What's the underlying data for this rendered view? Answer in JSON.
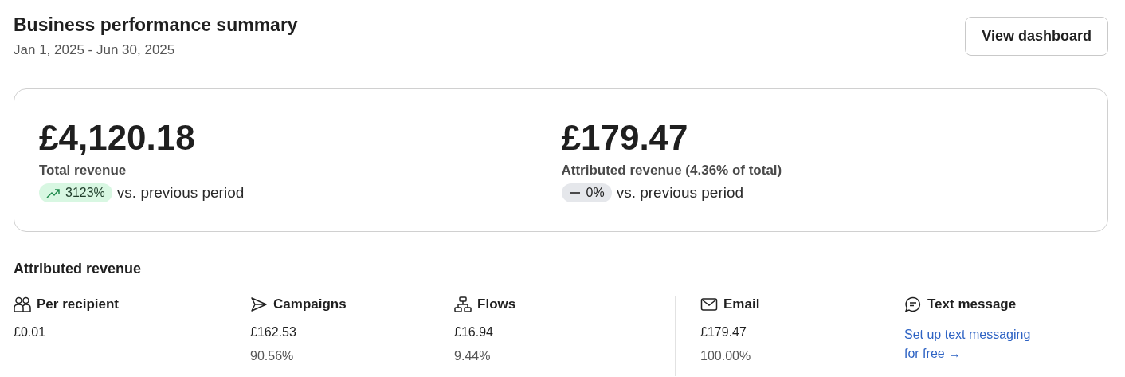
{
  "header": {
    "title": "Business performance summary",
    "date_range": "Jan 1, 2025 - Jun 30, 2025",
    "button": "View dashboard"
  },
  "summary": [
    {
      "amount": "£4,120.18",
      "label": "Total revenue",
      "kind": "up",
      "change": "3123%",
      "comparison": "vs. previous period"
    },
    {
      "amount": "£179.47",
      "label": "Attributed revenue (4.36% of total)",
      "kind": "flat",
      "change": "0%",
      "comparison": "vs. previous period"
    }
  ],
  "attributed_revenue": {
    "title": "Attributed revenue",
    "groups": [
      [
        {
          "kind": "metric",
          "name": "Per recipient",
          "value": "£0.01"
        }
      ],
      [
        {
          "kind": "metric",
          "name": "Campaigns",
          "value": "£162.53",
          "share": "90.56%"
        },
        {
          "kind": "metric",
          "name": "Flows",
          "value": "£16.94",
          "share": "9.44%"
        }
      ],
      [
        {
          "kind": "metric",
          "name": "Email",
          "value": "£179.47",
          "share": "100.00%"
        },
        {
          "kind": "link",
          "name": "Text message",
          "link": "Set up text messaging for free →"
        }
      ]
    ]
  }
}
